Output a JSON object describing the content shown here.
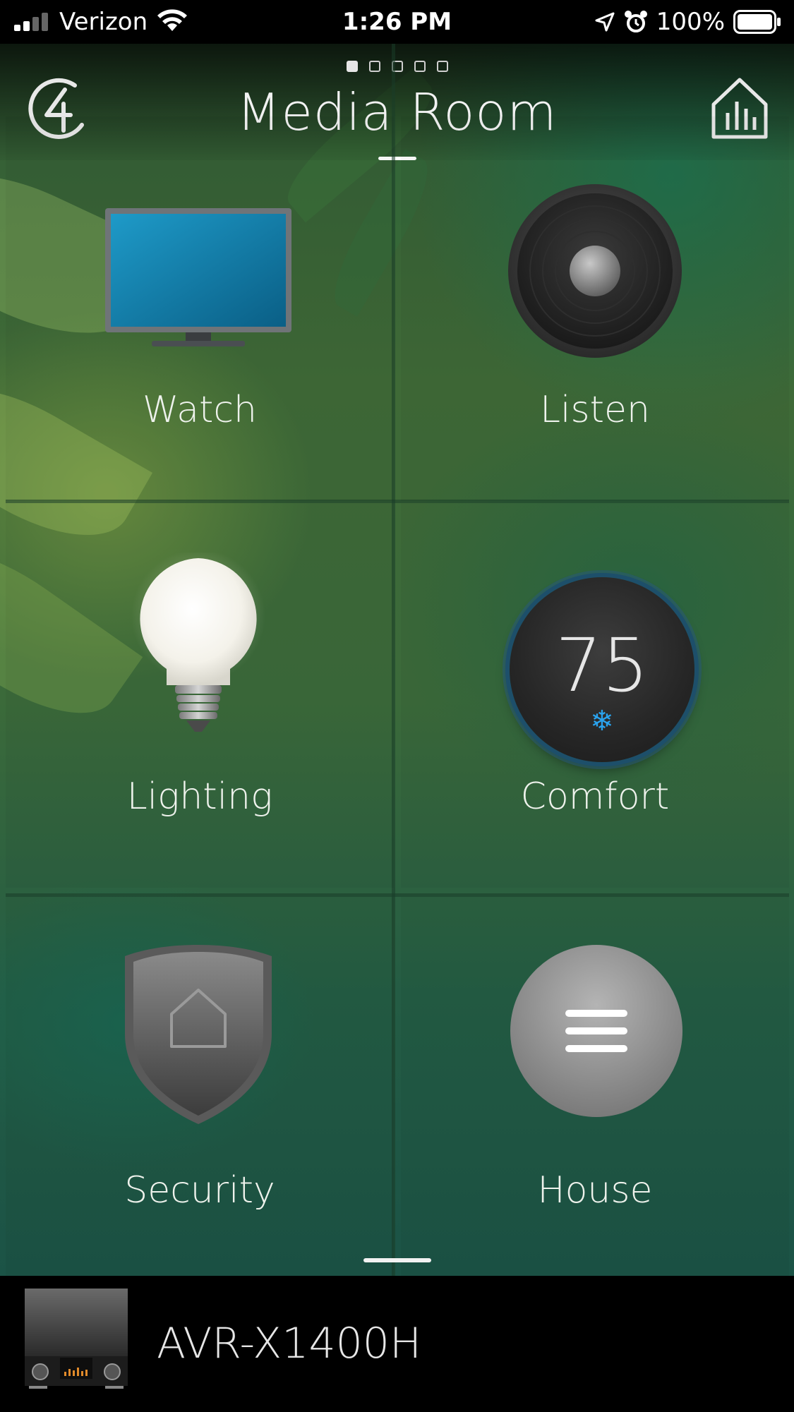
{
  "status_bar": {
    "carrier": "Verizon",
    "time": "1:26 PM",
    "battery": "100%",
    "icons": [
      "signal-icon",
      "wifi-icon",
      "location-arrow-icon",
      "alarm-icon",
      "battery-icon"
    ]
  },
  "header": {
    "title": "Media Room",
    "page_dots": {
      "count": 5,
      "active": 1
    },
    "left_icon": "control4-logo-icon",
    "right_icon": "bar-chart-icon"
  },
  "tiles": [
    {
      "label": "Watch",
      "icon": "tv-icon"
    },
    {
      "label": "Listen",
      "icon": "speaker-icon"
    },
    {
      "label": "Lighting",
      "icon": "light-bulb-icon"
    },
    {
      "label": "Comfort",
      "icon": "thermostat-icon",
      "temperature": "75",
      "mode": "❄",
      "mode_color": "#2aa3ee"
    },
    {
      "label": "Security",
      "icon": "security-shield-icon"
    },
    {
      "label": "House",
      "icon": "menu-icon"
    }
  ],
  "now_playing": {
    "device_name": "AVR-X1400H",
    "thumbnail_icon": "av-receiver-icon"
  },
  "colors": {
    "accent_blue": "#2aa3ee",
    "thermostat_ring": "#1d4f6a",
    "bottom_bar": "#000000"
  }
}
